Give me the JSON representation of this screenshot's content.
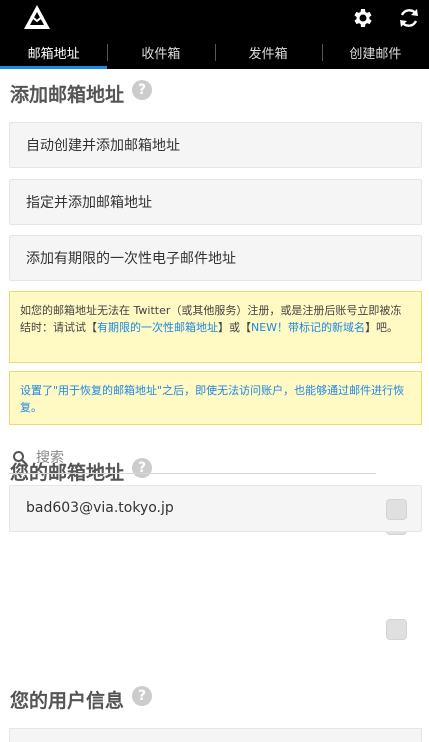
{
  "header": {
    "logo_icon": "triangle-mail-logo-icon",
    "settings_icon": "gear-icon",
    "refresh_icon": "refresh-icon"
  },
  "tabs": [
    {
      "label": "邮箱地址",
      "active": true
    },
    {
      "label": "收件箱",
      "active": false
    },
    {
      "label": "发件箱",
      "active": false
    },
    {
      "label": "创建邮件",
      "active": false
    }
  ],
  "add_section": {
    "title": "添加邮箱地址",
    "help_icon": "?",
    "buttons": [
      "自动创建并添加邮箱地址",
      "指定并添加邮箱地址",
      "添加有期限的一次性电子邮件地址"
    ]
  },
  "notice1": {
    "text_before": "如您的邮箱地址无法在 Twitter（或其他服务）注册，或是注册后账号立即被冻结时：请试试【",
    "link1": "有期限的一次性邮箱地址",
    "text_mid": "】或【",
    "link2": "NEW！带标记的新域名",
    "text_after": "】吧。"
  },
  "notice2": {
    "link": "设置了\"用于恢复的邮箱地址\"之后，即使无法访问账户，也能够通过邮件进行恢复。"
  },
  "addresses_section": {
    "title": "您的邮箱地址",
    "help_icon": "?",
    "search_placeholder": "搜索",
    "items": [
      {
        "address": "bad603@via.tokyo.jp"
      }
    ]
  },
  "user_section": {
    "title": "您的用户信息",
    "help_icon": "?"
  },
  "colors": {
    "topbar": "#000000",
    "tab_active_underline": "#1e88e5",
    "notice_bg": "#fff9c4",
    "link": "#1e88e5"
  }
}
